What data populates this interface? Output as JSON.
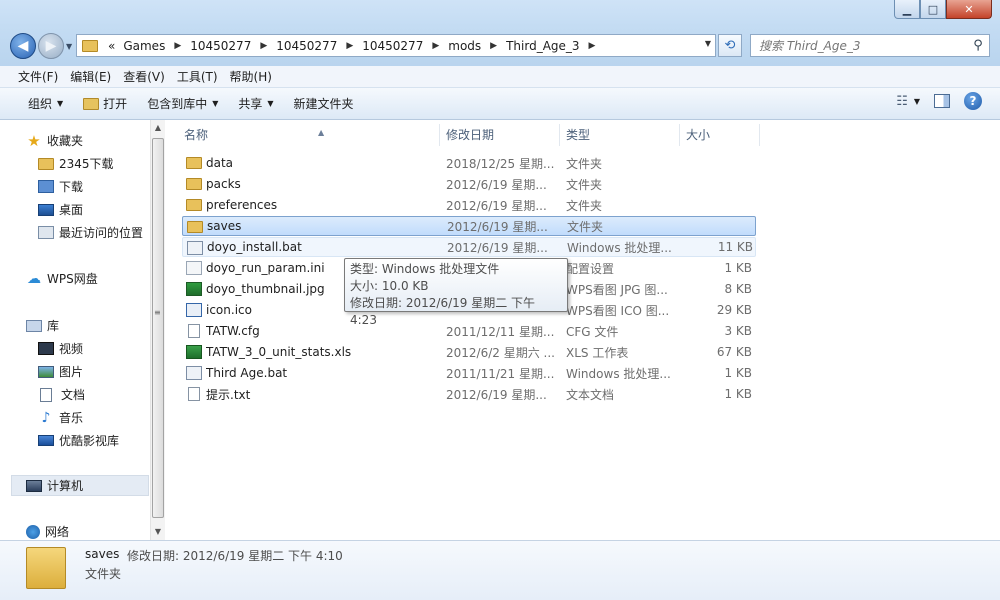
{
  "window": {
    "minimize_label": "▁",
    "maximize_label": "□",
    "close_label": "✕"
  },
  "nav": {
    "back_icon": "back-arrow-icon",
    "forward_icon": "forward-arrow-icon"
  },
  "address": {
    "overflow": "«",
    "crumbs": [
      "Games",
      "10450277",
      "10450277",
      "10450277",
      "mods",
      "Third_Age_3"
    ]
  },
  "search": {
    "placeholder": "搜索 Third_Age_3"
  },
  "menubar": {
    "items": [
      "文件(F)",
      "编辑(E)",
      "查看(V)",
      "工具(T)",
      "帮助(H)"
    ]
  },
  "toolbar": {
    "organize": "组织",
    "open": "打开",
    "include_library": "包含到库中",
    "share": "共享",
    "new_folder": "新建文件夹"
  },
  "navpane": {
    "favorites": "收藏夹",
    "fav_items": [
      "2345下载",
      "下载",
      "桌面",
      "最近访问的位置"
    ],
    "wps_cloud": "WPS网盘",
    "library": "库",
    "lib_items": [
      "视频",
      "图片",
      "文档",
      "音乐",
      "优酷影视库"
    ],
    "computer": "计算机",
    "network": "网络"
  },
  "columns": {
    "name": "名称",
    "date": "修改日期",
    "type": "类型",
    "size": "大小"
  },
  "files": [
    {
      "name": "data",
      "date": "2018/12/25 星期...",
      "type": "文件夹",
      "size": ""
    },
    {
      "name": "packs",
      "date": "2012/6/19 星期...",
      "type": "文件夹",
      "size": ""
    },
    {
      "name": "preferences",
      "date": "2012/6/19 星期...",
      "type": "文件夹",
      "size": ""
    },
    {
      "name": "saves",
      "date": "2012/6/19 星期...",
      "type": "文件夹",
      "size": ""
    },
    {
      "name": "doyo_install.bat",
      "date": "2012/6/19 星期...",
      "type": "Windows 批处理...",
      "size": "11 KB"
    },
    {
      "name": "doyo_run_param.ini",
      "date": "",
      "type": "配置设置",
      "size": "1 KB"
    },
    {
      "name": "doyo_thumbnail.jpg",
      "date": "",
      "type": "WPS看图 JPG 图...",
      "size": "8 KB"
    },
    {
      "name": "icon.ico",
      "date": "",
      "type": "WPS看图 ICO 图...",
      "size": "29 KB"
    },
    {
      "name": "TATW.cfg",
      "date": "2011/12/11 星期...",
      "type": "CFG 文件",
      "size": "3 KB"
    },
    {
      "name": "TATW_3_0_unit_stats.xls",
      "date": "2012/6/2 星期六 ...",
      "type": "XLS 工作表",
      "size": "67 KB"
    },
    {
      "name": "Third Age.bat",
      "date": "2011/11/21 星期...",
      "type": "Windows 批处理...",
      "size": "1 KB"
    },
    {
      "name": "提示.txt",
      "date": "2012/6/19 星期...",
      "type": "文本文档",
      "size": "1 KB"
    }
  ],
  "tooltip": {
    "line1": "类型: Windows 批处理文件",
    "line2": "大小: 10.0 KB",
    "line3": "修改日期: 2012/6/19 星期二 下午 4:23"
  },
  "details": {
    "name": "saves",
    "modified": "修改日期: 2012/6/19 星期二 下午 4:10",
    "type": "文件夹"
  }
}
